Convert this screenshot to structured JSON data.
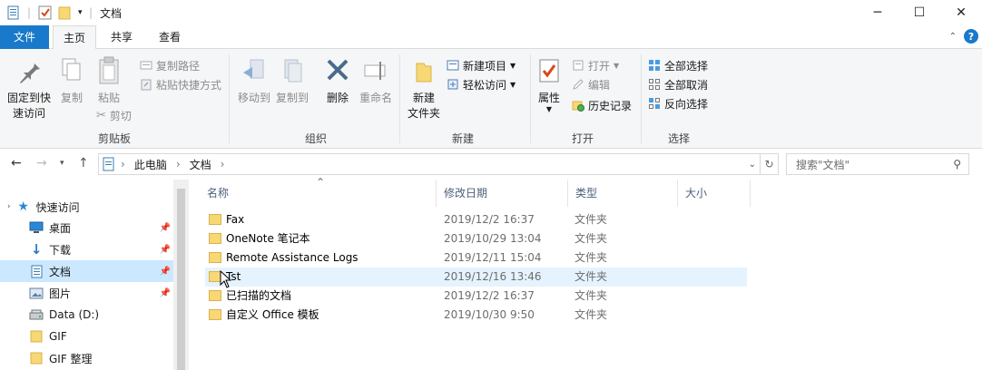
{
  "window": {
    "title": "文档",
    "minimize": "─",
    "maximize": "☐",
    "close": "✕"
  },
  "tabs": {
    "file": "文件",
    "home": "主页",
    "share": "共享",
    "view": "查看"
  },
  "ribbon": {
    "clipboard": {
      "label": "剪贴板",
      "pin": "固定到快\n速访问",
      "copy": "复制",
      "paste": "粘贴",
      "copy_path": "复制路径",
      "paste_shortcut": "粘贴快捷方式",
      "cut": "剪切"
    },
    "organize": {
      "label": "组织",
      "move_to": "移动到",
      "copy_to": "复制到",
      "delete": "删除",
      "rename": "重命名"
    },
    "new": {
      "label": "新建",
      "new_folder": "新建\n文件夹",
      "new_item": "新建项目",
      "easy_access": "轻松访问"
    },
    "open": {
      "label": "打开",
      "properties": "属性",
      "open": "打开",
      "edit": "编辑",
      "history": "历史记录"
    },
    "select": {
      "label": "选择",
      "select_all": "全部选择",
      "select_none": "全部取消",
      "invert": "反向选择"
    }
  },
  "address": {
    "crumbs": [
      "此电脑",
      "文档"
    ],
    "search_placeholder": "搜索\"文档\""
  },
  "nav": {
    "items": [
      {
        "label": "快速访问",
        "icon": "star-icon",
        "pinned": false
      },
      {
        "label": "桌面",
        "icon": "desktop-icon",
        "pinned": true
      },
      {
        "label": "下载",
        "icon": "download-icon",
        "pinned": true
      },
      {
        "label": "文档",
        "icon": "document-icon",
        "pinned": true,
        "selected": true
      },
      {
        "label": "图片",
        "icon": "pictures-icon",
        "pinned": true
      },
      {
        "label": "Data (D:)",
        "icon": "drive-icon",
        "pinned": false
      },
      {
        "label": "GIF",
        "icon": "folder-icon",
        "pinned": false
      },
      {
        "label": "GIF 整理",
        "icon": "folder-icon",
        "pinned": false
      }
    ]
  },
  "columns": {
    "name": "名称",
    "modified": "修改日期",
    "type": "类型",
    "size": "大小"
  },
  "files": [
    {
      "name": "Fax",
      "modified": "2019/12/2 16:37",
      "type": "文件夹"
    },
    {
      "name": "OneNote 笔记本",
      "modified": "2019/10/29 13:04",
      "type": "文件夹"
    },
    {
      "name": "Remote Assistance Logs",
      "modified": "2019/12/11 15:04",
      "type": "文件夹"
    },
    {
      "name": "Tst",
      "modified": "2019/12/16 13:46",
      "type": "文件夹",
      "hover": true
    },
    {
      "name": "已扫描的文档",
      "modified": "2019/12/2 16:37",
      "type": "文件夹"
    },
    {
      "name": "自定义 Office 模板",
      "modified": "2019/10/30 9:50",
      "type": "文件夹"
    }
  ],
  "colors": {
    "accent": "#1979ca",
    "selection": "#cce8ff",
    "hover": "#e5f3ff",
    "folder": "#f8d775"
  }
}
